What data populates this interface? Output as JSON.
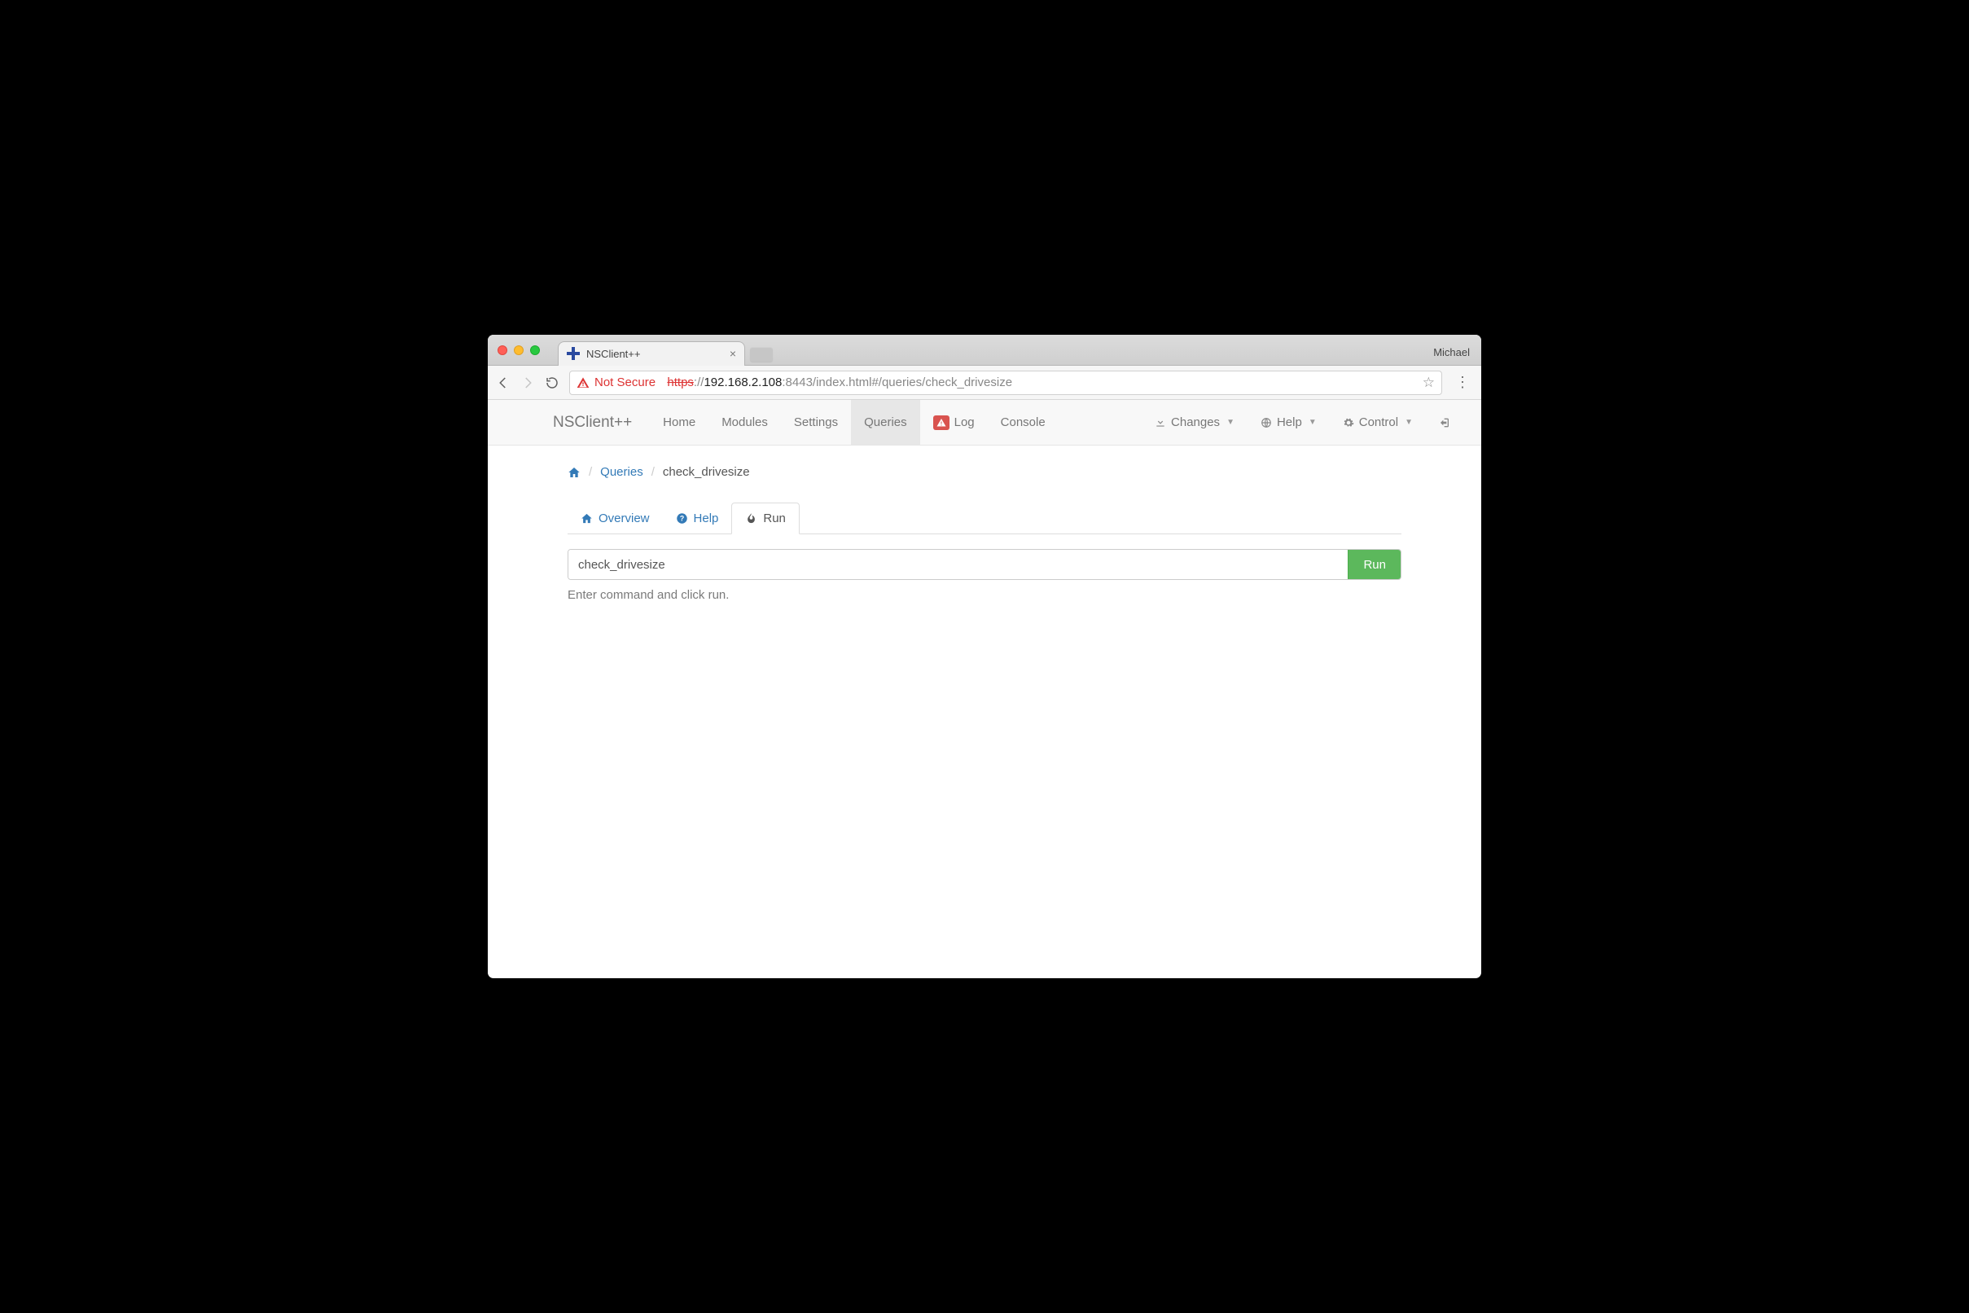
{
  "chrome": {
    "tab_title": "NSClient++",
    "profile": "Michael",
    "not_secure": "Not Secure",
    "url": {
      "scheme": "https",
      "sep1": "://",
      "host": "192.168.2.108",
      "port_path": ":8443/index.html#/queries/check_drivesize"
    }
  },
  "nav": {
    "brand": "NSClient++",
    "items": {
      "home": "Home",
      "modules": "Modules",
      "settings": "Settings",
      "queries": "Queries",
      "log": "Log",
      "console": "Console",
      "changes": "Changes",
      "help": "Help",
      "control": "Control"
    }
  },
  "breadcrumb": {
    "queries": "Queries",
    "current": "check_drivesize"
  },
  "subtabs": {
    "overview": "Overview",
    "help": "Help",
    "run": "Run"
  },
  "run": {
    "value": "check_drivesize",
    "button": "Run",
    "help": "Enter command and click run."
  }
}
